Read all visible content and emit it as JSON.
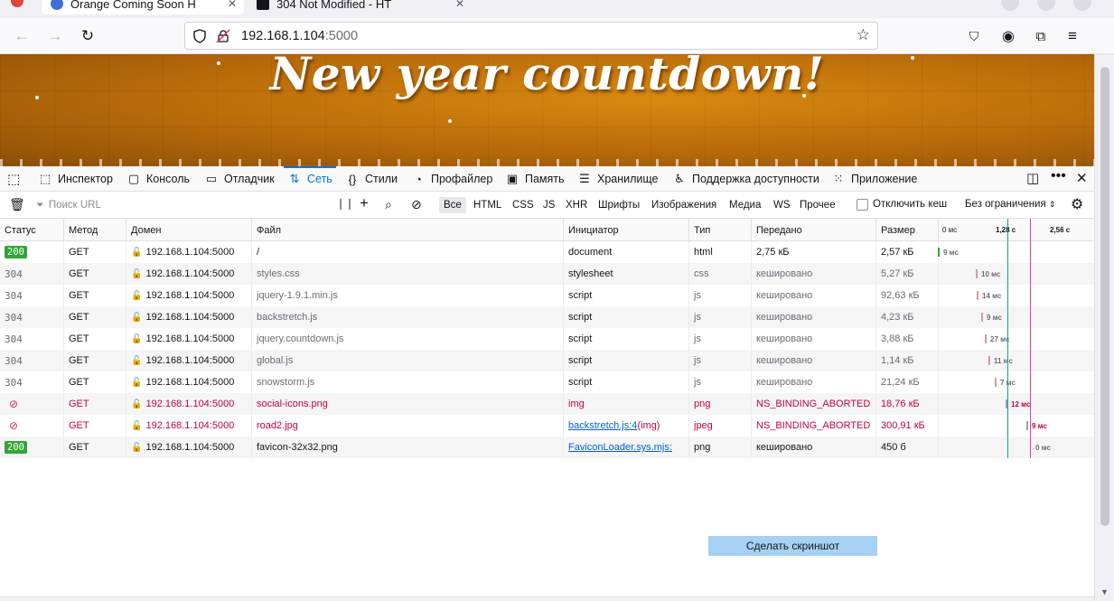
{
  "browser": {
    "tabs": [
      {
        "title": "Orange Coming Soon H",
        "active": true
      },
      {
        "title": "304 Not Modified - HT",
        "active": false
      }
    ],
    "url_host": "192.168.1.104",
    "url_port": ":5000"
  },
  "page": {
    "heading": "New year countdown!"
  },
  "devtools": {
    "tabs": [
      {
        "label": "Инспектор",
        "icon": "inspector-icon"
      },
      {
        "label": "Консоль",
        "icon": "console-icon"
      },
      {
        "label": "Отладчик",
        "icon": "debugger-icon"
      },
      {
        "label": "Сеть",
        "icon": "network-icon"
      },
      {
        "label": "Стили",
        "icon": "styles-icon"
      },
      {
        "label": "Профайлер",
        "icon": "profiler-icon"
      },
      {
        "label": "Память",
        "icon": "memory-icon"
      },
      {
        "label": "Хранилище",
        "icon": "storage-icon"
      },
      {
        "label": "Поддержка доступности",
        "icon": "accessibility-icon"
      },
      {
        "label": "Приложение",
        "icon": "application-icon"
      }
    ],
    "filter": {
      "placeholder": "Поиск URL",
      "types": [
        "Все",
        "HTML",
        "CSS",
        "JS",
        "XHR",
        "Шрифты",
        "Изображения",
        "Медиа",
        "WS",
        "Прочее"
      ],
      "disable_cache_label": "Отключить кеш",
      "throttle_label": "Без ограничения"
    },
    "columns": [
      "Статус",
      "Метод",
      "Домен",
      "Файл",
      "Инициатор",
      "Тип",
      "Передано",
      "Размер"
    ],
    "timeline_ticks": [
      "0 мс",
      "1,28 с",
      "2,56 с"
    ],
    "requests": [
      {
        "status": "200",
        "state": "ok",
        "method": "GET",
        "domain": "192.168.1.104:5000",
        "file": "/",
        "initiator": "document",
        "initiator_extra": "",
        "type": "html",
        "transferred": "2,75 кБ",
        "size": "2,57 кБ",
        "time": "9 мс",
        "start": 0.0,
        "duration_ms": 9
      },
      {
        "status": "304",
        "state": "cached",
        "method": "GET",
        "domain": "192.168.1.104:5000",
        "file": "styles.css",
        "initiator": "stylesheet",
        "initiator_extra": "",
        "type": "css",
        "transferred": "кешировано",
        "size": "5,27 кБ",
        "time": "10 мс",
        "start": 0.0,
        "duration_ms": 10
      },
      {
        "status": "304",
        "state": "cached",
        "method": "GET",
        "domain": "192.168.1.104:5000",
        "file": "jquery-1.9.1.min.js",
        "initiator": "script",
        "initiator_extra": "",
        "type": "js",
        "transferred": "кешировано",
        "size": "92,63 кБ",
        "time": "14 мс",
        "start": 0.0,
        "duration_ms": 14
      },
      {
        "status": "304",
        "state": "cached",
        "method": "GET",
        "domain": "192.168.1.104:5000",
        "file": "backstretch.js",
        "initiator": "script",
        "initiator_extra": "",
        "type": "js",
        "transferred": "кешировано",
        "size": "4,23 кБ",
        "time": "9 мс",
        "start": 0.0,
        "duration_ms": 9
      },
      {
        "status": "304",
        "state": "cached",
        "method": "GET",
        "domain": "192.168.1.104:5000",
        "file": "jquery.countdown.js",
        "initiator": "script",
        "initiator_extra": "",
        "type": "js",
        "transferred": "кешировано",
        "size": "3,88 кБ",
        "time": "27 мс",
        "start": 0.0,
        "duration_ms": 27
      },
      {
        "status": "304",
        "state": "cached",
        "method": "GET",
        "domain": "192.168.1.104:5000",
        "file": "global.js",
        "initiator": "script",
        "initiator_extra": "",
        "type": "js",
        "transferred": "кешировано",
        "size": "1,14 кБ",
        "time": "11 мс",
        "start": 0.0,
        "duration_ms": 11
      },
      {
        "status": "304",
        "state": "cached",
        "method": "GET",
        "domain": "192.168.1.104:5000",
        "file": "snowstorm.js",
        "initiator": "script",
        "initiator_extra": "",
        "type": "js",
        "transferred": "кешировано",
        "size": "21,24 кБ",
        "time": "7 мс",
        "start": 0.0,
        "duration_ms": 7
      },
      {
        "status": "",
        "state": "blocked",
        "method": "GET",
        "domain": "192.168.1.104:5000",
        "file": "social-icons.png",
        "initiator": "img",
        "initiator_extra": "",
        "type": "png",
        "transferred": "NS_BINDING_ABORTED",
        "size": "18,76 кБ",
        "time": "12 мс",
        "start": 0.0,
        "duration_ms": 12
      },
      {
        "status": "",
        "state": "blocked",
        "method": "GET",
        "domain": "192.168.1.104:5000",
        "file": "road2.jpg",
        "initiator": "backstretch.js:4",
        "initiator_extra": " (img)",
        "type": "jpeg",
        "transferred": "NS_BINDING_ABORTED",
        "size": "300,91 кБ",
        "time": "9 мс",
        "start": 0.0,
        "duration_ms": 9
      },
      {
        "status": "200",
        "state": "ok",
        "method": "GET",
        "domain": "192.168.1.104:5000",
        "file": "favicon-32x32.png",
        "initiator": "FaviconLoader.sys.mjs:",
        "initiator_extra": "",
        "type": "png",
        "transferred": "кешировано",
        "size": "450 б",
        "time": "0 мс",
        "start": 0.0,
        "duration_ms": 0
      }
    ],
    "screenshot_button": "Сделать скриншот"
  }
}
